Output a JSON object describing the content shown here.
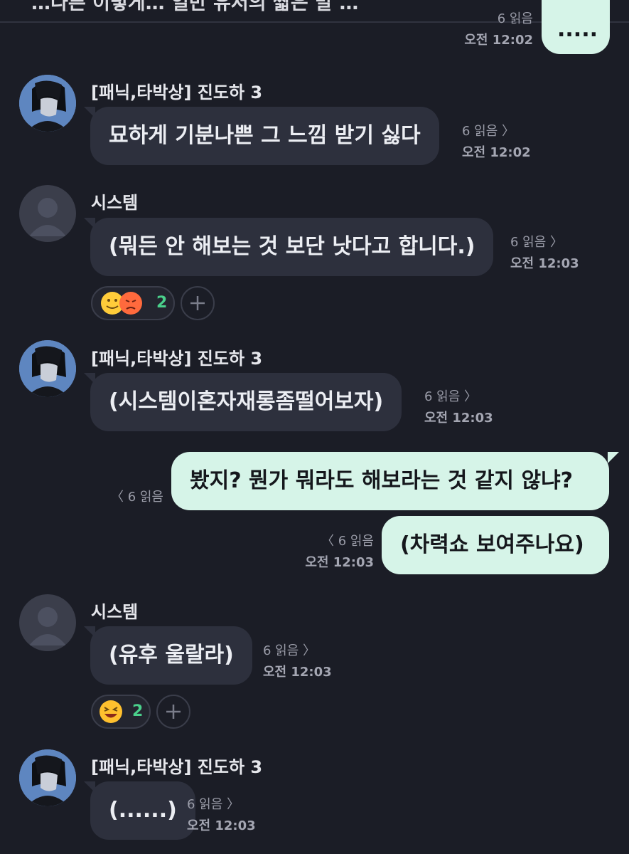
{
  "banner": {
    "text": "…다른 이렇게… 일반 유저의 짧은 말 …"
  },
  "messages": [
    {
      "id": "m0",
      "side": "out",
      "text": ".....",
      "read": "6 읽음",
      "time": "오전 12:02"
    },
    {
      "id": "m1",
      "side": "in",
      "sender": "[패닉,타박상] 진도하 3",
      "text": "묘하게 기분나쁜 그 느낌 받기 싫다",
      "read": "6 읽음",
      "time": "오전 12:02",
      "avatar": "character-avatar"
    },
    {
      "id": "m2",
      "side": "in",
      "sender": "시스템",
      "text": "(뭐든 안 해보는 것 보단 낫다고 합니다.)",
      "read": "6 읽음",
      "time": "오전 12:03",
      "avatar": "default-avatar",
      "reaction": {
        "emojis": [
          "grinning-thumbs-up",
          "angry-face"
        ],
        "count": "2"
      }
    },
    {
      "id": "m3",
      "side": "in",
      "sender": "[패닉,타박상] 진도하 3",
      "text": "(시스템이혼자재롱좀떨어보자)",
      "read": "6 읽음",
      "time": "오전 12:03",
      "avatar": "character-avatar"
    },
    {
      "id": "m4",
      "side": "out",
      "text": "봤지? 뭔가 뭐라도 해보라는 것 같지 않냐?",
      "read": "6 읽음",
      "time": ""
    },
    {
      "id": "m5",
      "side": "out",
      "text": "(차력쇼 보여주나요)",
      "read": "6 읽음",
      "time": "오전 12:03"
    },
    {
      "id": "m6",
      "side": "in",
      "sender": "시스템",
      "text": "(유후 울랄라)",
      "read": "6 읽음",
      "time": "오전 12:03",
      "avatar": "default-avatar",
      "reaction": {
        "emojis": [
          "laughing-face"
        ],
        "count": "2"
      }
    },
    {
      "id": "m7",
      "side": "in",
      "sender": "[패닉,타박상] 진도하 3",
      "text": "(......)",
      "read": "6 읽음",
      "time": "오전 12:03",
      "avatar": "character-avatar"
    }
  ],
  "colors": {
    "background": "#1b1d26",
    "bubble_in": "#2d303d",
    "bubble_out": "#d6f4e8",
    "reaction_count": "#4ad08b"
  }
}
